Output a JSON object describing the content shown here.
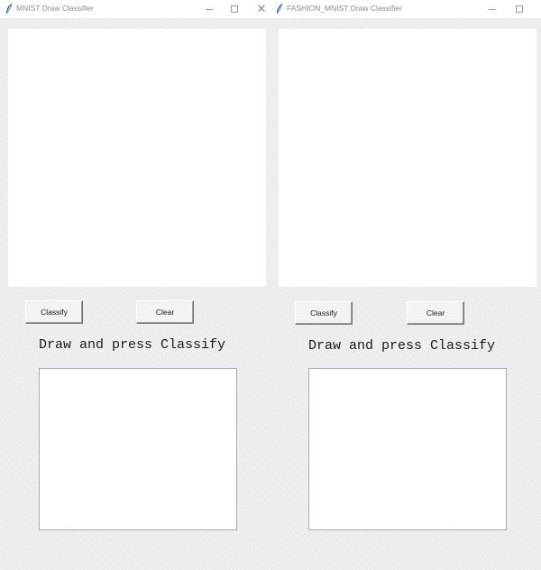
{
  "windows": [
    {
      "title": "MNIST Draw Classifier",
      "classify_label": "Classify",
      "clear_label": "Clear",
      "status_text": "Draw and press Classify"
    },
    {
      "title": "FASHION_MNIST Draw Classifier",
      "classify_label": "Classify",
      "clear_label": "Clear",
      "status_text": "Draw and press Classify"
    }
  ],
  "titlebar_controls": {
    "close_glyph": "✕"
  },
  "icons": {
    "app": "feather-icon",
    "minimize": "minimize-icon",
    "maximize": "maximize-icon",
    "close": "close-icon"
  },
  "colors": {
    "window_bg": "#f0f0f0",
    "canvas_bg": "#ffffff",
    "icon_blue": "#2f5fa8"
  }
}
